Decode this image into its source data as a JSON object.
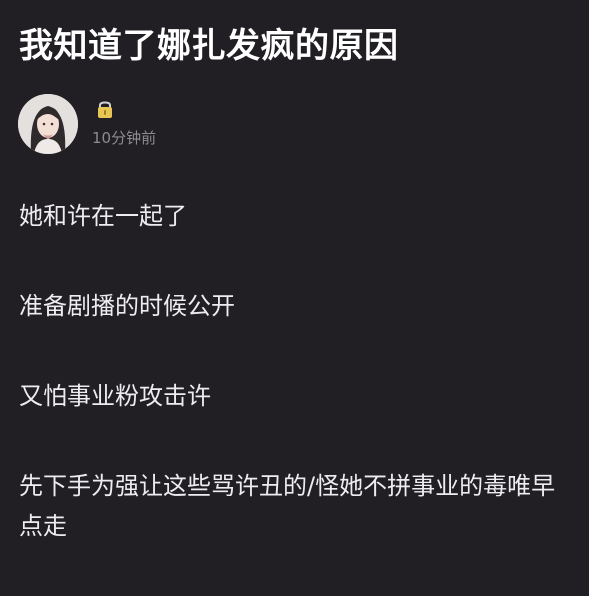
{
  "post": {
    "title": "我知道了娜扎发疯的原因",
    "time": "10分钟前",
    "paragraphs": [
      "她和许在一起了",
      "准备剧播的时候公开",
      "又怕事业粉攻击许",
      "先下手为强让这些骂许丑的/怪她不拼事业的毒唯早点走"
    ]
  },
  "icons": {
    "lock": "lock-icon",
    "avatar": "user-avatar"
  },
  "colors": {
    "background": "#221f24",
    "text": "#eeecef",
    "muted": "#8d8a90",
    "lock": "#e7c655"
  }
}
